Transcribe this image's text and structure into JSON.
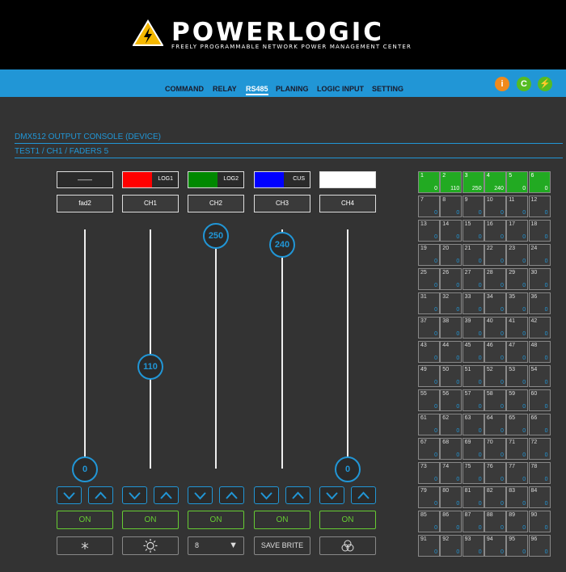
{
  "brand": {
    "title": "POWERLOGIC",
    "subtitle": "FREELY PROGRAMMABLE NETWORK POWER MANAGEMENT CENTER"
  },
  "nav": {
    "items": [
      {
        "label": "COMMAND",
        "active": false
      },
      {
        "label": "RELAY",
        "active": false
      },
      {
        "label": "RS485",
        "active": true
      },
      {
        "label": "PLANING",
        "active": false
      },
      {
        "label": "LOGIC INPUT",
        "active": false
      },
      {
        "label": "SETTING",
        "active": false
      }
    ],
    "info_glyph": "i",
    "settings_glyph": "C",
    "power_glyph": "⚡"
  },
  "section": {
    "title": "DMX512 OUTPUT CONSOLE (DEVICE)",
    "subtitle": "TEST1 / CH1 / FADERS 5"
  },
  "faders": [
    {
      "label": "——",
      "color": "",
      "channel": "fad2",
      "value": "0",
      "on": "ON"
    },
    {
      "label": "LOG1",
      "color": "#ff0000",
      "channel": "CH1",
      "value": "110",
      "on": "ON"
    },
    {
      "label": "LOG2",
      "color": "#008800",
      "channel": "CH2",
      "value": "250",
      "on": "ON"
    },
    {
      "label": "CUS",
      "color": "#0000ff",
      "channel": "CH3",
      "value": "240",
      "on": "ON"
    },
    {
      "label": "",
      "color": "#ffffff",
      "channel": "CH4",
      "value": "0",
      "on": "ON"
    }
  ],
  "tools": {
    "select_value": "8",
    "save_label": "SAVE BRITE"
  },
  "dmx_grid": {
    "cells": [
      {
        "n": "1",
        "v": "0"
      },
      {
        "n": "2",
        "v": "110"
      },
      {
        "n": "3",
        "v": "250"
      },
      {
        "n": "4",
        "v": "240"
      },
      {
        "n": "5",
        "v": "0"
      },
      {
        "n": "6",
        "v": "0"
      },
      {
        "n": "7",
        "v": "0"
      },
      {
        "n": "8",
        "v": "0"
      },
      {
        "n": "9",
        "v": "0"
      },
      {
        "n": "10",
        "v": "0"
      },
      {
        "n": "11",
        "v": "0"
      },
      {
        "n": "12",
        "v": "0"
      },
      {
        "n": "13",
        "v": "0"
      },
      {
        "n": "14",
        "v": "0"
      },
      {
        "n": "15",
        "v": "0"
      },
      {
        "n": "16",
        "v": "0"
      },
      {
        "n": "17",
        "v": "0"
      },
      {
        "n": "18",
        "v": "0"
      },
      {
        "n": "19",
        "v": "0"
      },
      {
        "n": "20",
        "v": "0"
      },
      {
        "n": "21",
        "v": "0"
      },
      {
        "n": "22",
        "v": "0"
      },
      {
        "n": "23",
        "v": "0"
      },
      {
        "n": "24",
        "v": "0"
      },
      {
        "n": "25",
        "v": "0"
      },
      {
        "n": "26",
        "v": "0"
      },
      {
        "n": "27",
        "v": "0"
      },
      {
        "n": "28",
        "v": "0"
      },
      {
        "n": "29",
        "v": "0"
      },
      {
        "n": "30",
        "v": "0"
      },
      {
        "n": "31",
        "v": "0"
      },
      {
        "n": "32",
        "v": "0"
      },
      {
        "n": "33",
        "v": "0"
      },
      {
        "n": "34",
        "v": "0"
      },
      {
        "n": "35",
        "v": "0"
      },
      {
        "n": "36",
        "v": "0"
      },
      {
        "n": "37",
        "v": "0"
      },
      {
        "n": "38",
        "v": "0"
      },
      {
        "n": "39",
        "v": "0"
      },
      {
        "n": "40",
        "v": "0"
      },
      {
        "n": "41",
        "v": "0"
      },
      {
        "n": "42",
        "v": "0"
      },
      {
        "n": "43",
        "v": "0"
      },
      {
        "n": "44",
        "v": "0"
      },
      {
        "n": "45",
        "v": "0"
      },
      {
        "n": "46",
        "v": "0"
      },
      {
        "n": "47",
        "v": "0"
      },
      {
        "n": "48",
        "v": "0"
      },
      {
        "n": "49",
        "v": "0"
      },
      {
        "n": "50",
        "v": "0"
      },
      {
        "n": "51",
        "v": "0"
      },
      {
        "n": "52",
        "v": "0"
      },
      {
        "n": "53",
        "v": "0"
      },
      {
        "n": "54",
        "v": "0"
      },
      {
        "n": "55",
        "v": "0"
      },
      {
        "n": "56",
        "v": "0"
      },
      {
        "n": "57",
        "v": "0"
      },
      {
        "n": "58",
        "v": "0"
      },
      {
        "n": "59",
        "v": "0"
      },
      {
        "n": "60",
        "v": "0"
      },
      {
        "n": "61",
        "v": "0"
      },
      {
        "n": "62",
        "v": "0"
      },
      {
        "n": "63",
        "v": "0"
      },
      {
        "n": "64",
        "v": "0"
      },
      {
        "n": "65",
        "v": "0"
      },
      {
        "n": "66",
        "v": "0"
      },
      {
        "n": "67",
        "v": "0"
      },
      {
        "n": "68",
        "v": "0"
      },
      {
        "n": "69",
        "v": "0"
      },
      {
        "n": "70",
        "v": "0"
      },
      {
        "n": "71",
        "v": "0"
      },
      {
        "n": "72",
        "v": "0"
      },
      {
        "n": "73",
        "v": "0"
      },
      {
        "n": "74",
        "v": "0"
      },
      {
        "n": "75",
        "v": "0"
      },
      {
        "n": "76",
        "v": "0"
      },
      {
        "n": "77",
        "v": "0"
      },
      {
        "n": "78",
        "v": "0"
      },
      {
        "n": "79",
        "v": "0"
      },
      {
        "n": "80",
        "v": "0"
      },
      {
        "n": "81",
        "v": "0"
      },
      {
        "n": "82",
        "v": "0"
      },
      {
        "n": "83",
        "v": "0"
      },
      {
        "n": "84",
        "v": "0"
      },
      {
        "n": "85",
        "v": "0"
      },
      {
        "n": "86",
        "v": "0"
      },
      {
        "n": "87",
        "v": "0"
      },
      {
        "n": "88",
        "v": "0"
      },
      {
        "n": "89",
        "v": "0"
      },
      {
        "n": "90",
        "v": "0"
      },
      {
        "n": "91",
        "v": "0"
      },
      {
        "n": "92",
        "v": "0"
      },
      {
        "n": "93",
        "v": "0"
      },
      {
        "n": "94",
        "v": "0"
      },
      {
        "n": "95",
        "v": "0"
      },
      {
        "n": "96",
        "v": "0"
      }
    ],
    "active_count": 6
  },
  "colors": {
    "accent": "#2196d6",
    "on": "#66cc33",
    "active_cell": "#22aa22",
    "info": "#f08a1c",
    "action": "#55bb22"
  }
}
